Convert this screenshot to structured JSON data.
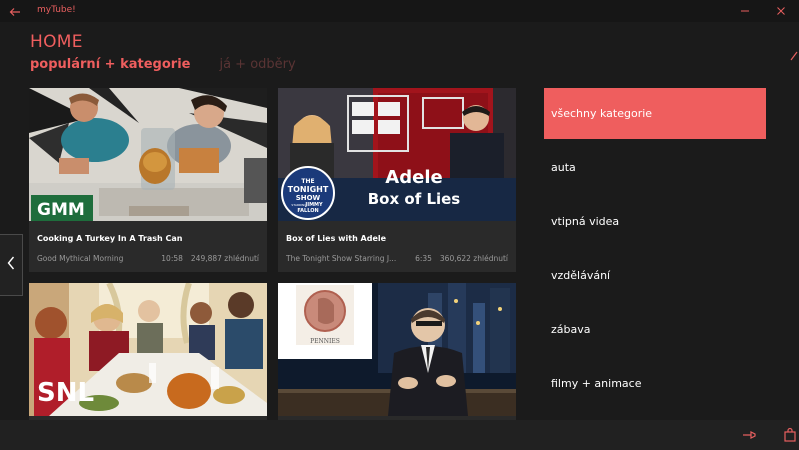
{
  "app": {
    "title": "myTube!"
  },
  "header": {
    "title": "HOME",
    "pivots": [
      {
        "label": "populární + kategorie"
      },
      {
        "label": "já + odběry"
      }
    ]
  },
  "videos": [
    {
      "title": "Cooking A Turkey In A Trash Can",
      "channel": "Good Mythical Morning",
      "duration": "10:58",
      "views": "249,887 zhlédnutí",
      "thumb_text": "GMM"
    },
    {
      "title": "Box of Lies with Adele",
      "channel": "The Tonight Show Starring J...",
      "duration": "6:35",
      "views": "360,622 zhlédnutí",
      "thumb_text": [
        "Adele",
        "Box of Lies"
      ],
      "thumb_logo": [
        "THE",
        "TONIGHT",
        "SHOW",
        "STARRING",
        "JIMMY",
        "FALLON"
      ]
    },
    {
      "thumb_text": "SNL"
    },
    {
      "thumb_text": "PENNIES"
    }
  ],
  "categories": [
    {
      "label": "všechny kategorie",
      "selected": true
    },
    {
      "label": "auta"
    },
    {
      "label": "vtipná videa"
    },
    {
      "label": "vzdělávání"
    },
    {
      "label": "zábava"
    },
    {
      "label": "filmy + animace"
    }
  ],
  "icons": {
    "back": "back-arrow-icon",
    "minimize": "minimize-icon",
    "close": "close-icon",
    "prev": "chevron-left-icon",
    "pin": "pin-icon",
    "bag": "shopping-bag-icon"
  },
  "colors": {
    "accent": "#ef5e5e",
    "background": "#1b1b1b",
    "card": "#2a2a2a"
  }
}
